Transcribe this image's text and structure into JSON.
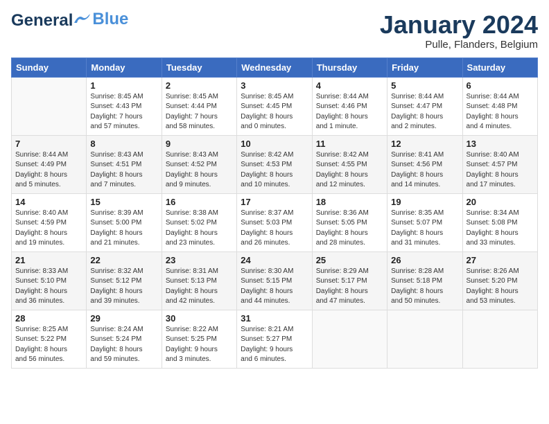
{
  "header": {
    "logo_line1": "General",
    "logo_line2": "Blue",
    "month_title": "January 2024",
    "subtitle": "Pulle, Flanders, Belgium"
  },
  "days_of_week": [
    "Sunday",
    "Monday",
    "Tuesday",
    "Wednesday",
    "Thursday",
    "Friday",
    "Saturday"
  ],
  "weeks": [
    [
      {
        "day": "",
        "info": ""
      },
      {
        "day": "1",
        "info": "Sunrise: 8:45 AM\nSunset: 4:43 PM\nDaylight: 7 hours\nand 57 minutes."
      },
      {
        "day": "2",
        "info": "Sunrise: 8:45 AM\nSunset: 4:44 PM\nDaylight: 7 hours\nand 58 minutes."
      },
      {
        "day": "3",
        "info": "Sunrise: 8:45 AM\nSunset: 4:45 PM\nDaylight: 8 hours\nand 0 minutes."
      },
      {
        "day": "4",
        "info": "Sunrise: 8:44 AM\nSunset: 4:46 PM\nDaylight: 8 hours\nand 1 minute."
      },
      {
        "day": "5",
        "info": "Sunrise: 8:44 AM\nSunset: 4:47 PM\nDaylight: 8 hours\nand 2 minutes."
      },
      {
        "day": "6",
        "info": "Sunrise: 8:44 AM\nSunset: 4:48 PM\nDaylight: 8 hours\nand 4 minutes."
      }
    ],
    [
      {
        "day": "7",
        "info": "Sunrise: 8:44 AM\nSunset: 4:49 PM\nDaylight: 8 hours\nand 5 minutes."
      },
      {
        "day": "8",
        "info": "Sunrise: 8:43 AM\nSunset: 4:51 PM\nDaylight: 8 hours\nand 7 minutes."
      },
      {
        "day": "9",
        "info": "Sunrise: 8:43 AM\nSunset: 4:52 PM\nDaylight: 8 hours\nand 9 minutes."
      },
      {
        "day": "10",
        "info": "Sunrise: 8:42 AM\nSunset: 4:53 PM\nDaylight: 8 hours\nand 10 minutes."
      },
      {
        "day": "11",
        "info": "Sunrise: 8:42 AM\nSunset: 4:55 PM\nDaylight: 8 hours\nand 12 minutes."
      },
      {
        "day": "12",
        "info": "Sunrise: 8:41 AM\nSunset: 4:56 PM\nDaylight: 8 hours\nand 14 minutes."
      },
      {
        "day": "13",
        "info": "Sunrise: 8:40 AM\nSunset: 4:57 PM\nDaylight: 8 hours\nand 17 minutes."
      }
    ],
    [
      {
        "day": "14",
        "info": "Sunrise: 8:40 AM\nSunset: 4:59 PM\nDaylight: 8 hours\nand 19 minutes."
      },
      {
        "day": "15",
        "info": "Sunrise: 8:39 AM\nSunset: 5:00 PM\nDaylight: 8 hours\nand 21 minutes."
      },
      {
        "day": "16",
        "info": "Sunrise: 8:38 AM\nSunset: 5:02 PM\nDaylight: 8 hours\nand 23 minutes."
      },
      {
        "day": "17",
        "info": "Sunrise: 8:37 AM\nSunset: 5:03 PM\nDaylight: 8 hours\nand 26 minutes."
      },
      {
        "day": "18",
        "info": "Sunrise: 8:36 AM\nSunset: 5:05 PM\nDaylight: 8 hours\nand 28 minutes."
      },
      {
        "day": "19",
        "info": "Sunrise: 8:35 AM\nSunset: 5:07 PM\nDaylight: 8 hours\nand 31 minutes."
      },
      {
        "day": "20",
        "info": "Sunrise: 8:34 AM\nSunset: 5:08 PM\nDaylight: 8 hours\nand 33 minutes."
      }
    ],
    [
      {
        "day": "21",
        "info": "Sunrise: 8:33 AM\nSunset: 5:10 PM\nDaylight: 8 hours\nand 36 minutes."
      },
      {
        "day": "22",
        "info": "Sunrise: 8:32 AM\nSunset: 5:12 PM\nDaylight: 8 hours\nand 39 minutes."
      },
      {
        "day": "23",
        "info": "Sunrise: 8:31 AM\nSunset: 5:13 PM\nDaylight: 8 hours\nand 42 minutes."
      },
      {
        "day": "24",
        "info": "Sunrise: 8:30 AM\nSunset: 5:15 PM\nDaylight: 8 hours\nand 44 minutes."
      },
      {
        "day": "25",
        "info": "Sunrise: 8:29 AM\nSunset: 5:17 PM\nDaylight: 8 hours\nand 47 minutes."
      },
      {
        "day": "26",
        "info": "Sunrise: 8:28 AM\nSunset: 5:18 PM\nDaylight: 8 hours\nand 50 minutes."
      },
      {
        "day": "27",
        "info": "Sunrise: 8:26 AM\nSunset: 5:20 PM\nDaylight: 8 hours\nand 53 minutes."
      }
    ],
    [
      {
        "day": "28",
        "info": "Sunrise: 8:25 AM\nSunset: 5:22 PM\nDaylight: 8 hours\nand 56 minutes."
      },
      {
        "day": "29",
        "info": "Sunrise: 8:24 AM\nSunset: 5:24 PM\nDaylight: 8 hours\nand 59 minutes."
      },
      {
        "day": "30",
        "info": "Sunrise: 8:22 AM\nSunset: 5:25 PM\nDaylight: 9 hours\nand 3 minutes."
      },
      {
        "day": "31",
        "info": "Sunrise: 8:21 AM\nSunset: 5:27 PM\nDaylight: 9 hours\nand 6 minutes."
      },
      {
        "day": "",
        "info": ""
      },
      {
        "day": "",
        "info": ""
      },
      {
        "day": "",
        "info": ""
      }
    ]
  ]
}
